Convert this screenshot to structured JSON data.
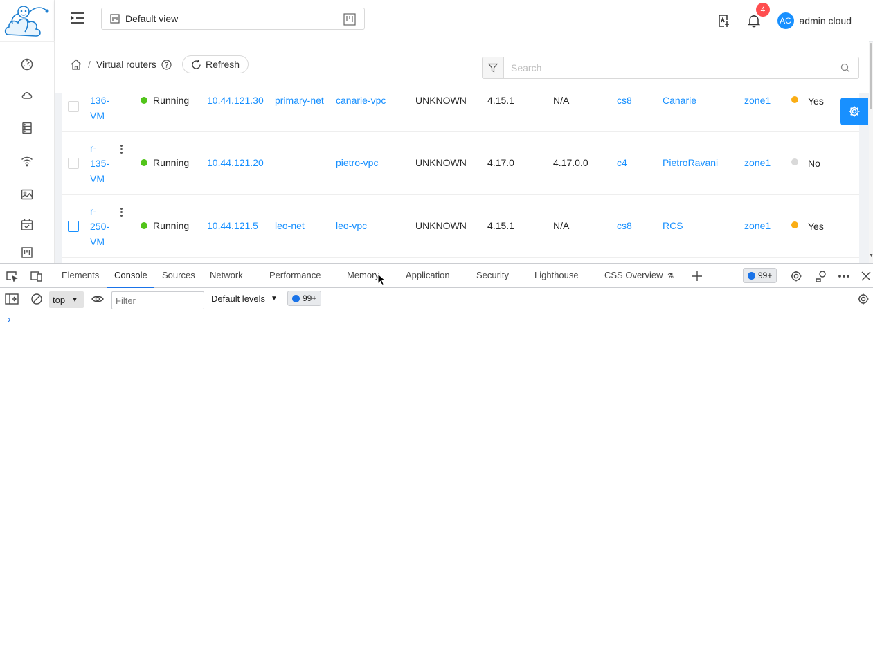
{
  "header": {
    "view_label": "Default view",
    "notification_count": "4",
    "avatar_initials": "AC",
    "username": "admin cloud"
  },
  "breadcrumb": {
    "current": "Virtual routers"
  },
  "toolbar": {
    "refresh_label": "Refresh",
    "search_placeholder": "Search"
  },
  "sidebar": {
    "items": [
      "dashboard-icon",
      "cloud-icon",
      "storage-icon",
      "wifi-icon",
      "image-icon",
      "calendar-icon",
      "project-icon"
    ]
  },
  "routers": [
    {
      "name": "136-VM",
      "name_lines": [
        "136-",
        "VM"
      ],
      "state": "Running",
      "ip": "10.44.121.30",
      "network": "primary-net",
      "vpc": "canarie-vpc",
      "redundant": "UNKNOWN",
      "version": "4.15.1",
      "software": "N/A",
      "host": "cs8",
      "account": "Canarie",
      "zone": "zone1",
      "requires_upgrade": "Yes",
      "upgrade_color": "#faad14"
    },
    {
      "name": "r-135-VM",
      "name_lines": [
        "r-",
        "135-",
        "VM"
      ],
      "state": "Running",
      "ip": "10.44.121.20",
      "network": "",
      "vpc": "pietro-vpc",
      "redundant": "UNKNOWN",
      "version": "4.17.0",
      "software": "4.17.0.0",
      "host": "c4",
      "account": "PietroRavani",
      "zone": "zone1",
      "requires_upgrade": "No",
      "upgrade_color": "#d9d9d9"
    },
    {
      "name": "r-250-VM",
      "name_lines": [
        "r-",
        "250-",
        "VM"
      ],
      "state": "Running",
      "ip": "10.44.121.5",
      "network": "leo-net",
      "vpc": "leo-vpc",
      "redundant": "UNKNOWN",
      "version": "4.15.1",
      "software": "N/A",
      "host": "cs8",
      "account": "RCS",
      "zone": "zone1",
      "requires_upgrade": "Yes",
      "upgrade_color": "#faad14"
    }
  ],
  "devtools": {
    "tabs": [
      "Elements",
      "Console",
      "Sources",
      "Network",
      "Performance",
      "Memory",
      "Application",
      "Security",
      "Lighthouse",
      "CSS Overview"
    ],
    "active_tab": "Console",
    "issues_badge": "99+",
    "context": "top",
    "filter_placeholder": "Filter",
    "levels": "Default levels",
    "console_badge": "99+",
    "prompt": "›"
  }
}
